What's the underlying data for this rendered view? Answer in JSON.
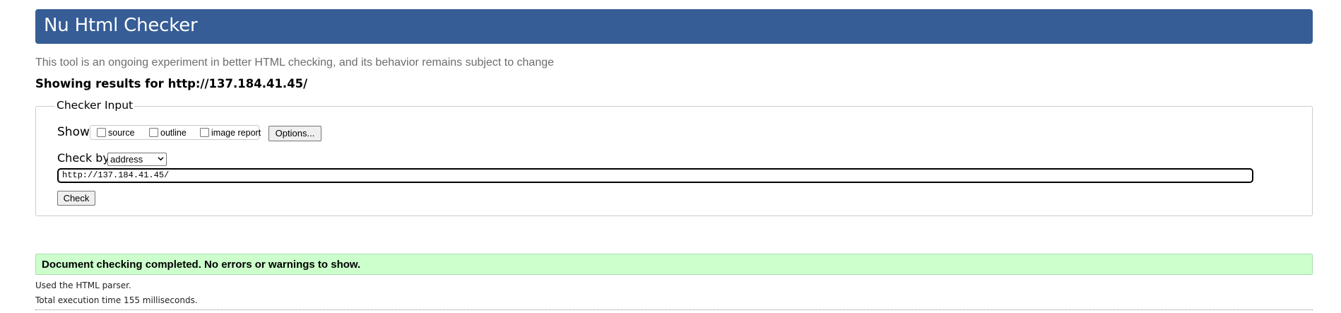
{
  "header": {
    "title": "Nu Html Checker"
  },
  "subtitle": "This tool is an ongoing experiment in better HTML checking, and its behavior remains subject to change",
  "showing": "Showing results for http://137.184.41.45/",
  "checker_input": {
    "legend": "Checker Input",
    "show_label": "Show",
    "options": [
      {
        "label": "source",
        "checked": false
      },
      {
        "label": "outline",
        "checked": false
      },
      {
        "label": "image report",
        "checked": false
      }
    ],
    "options_button": "Options...",
    "check_by_label": "Check by",
    "check_by_selected": "address",
    "url_value": "http://137.184.41.45/",
    "check_button": "Check"
  },
  "result": {
    "message": "Document checking completed. No errors or warnings to show.",
    "parser": "Used the HTML parser.",
    "execution_time": "Total execution time 155 milliseconds."
  }
}
